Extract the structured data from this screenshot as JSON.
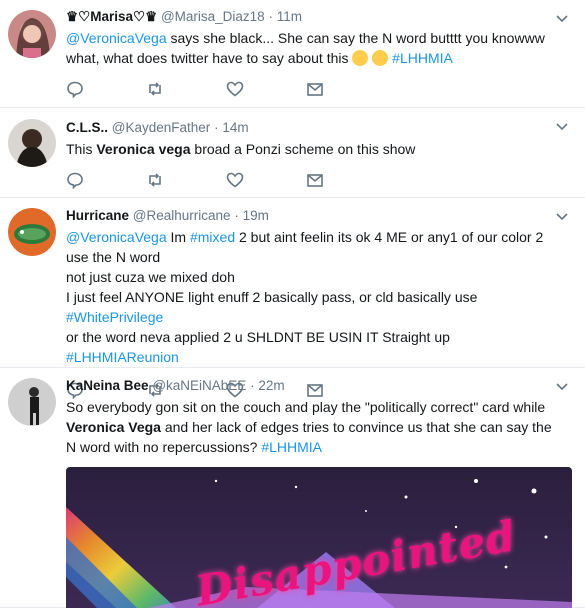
{
  "tweets": [
    {
      "fullname": "♛♡Marisa♡♛",
      "handle": "@Marisa_Diaz18",
      "time": "11m",
      "segments": [
        {
          "type": "mention",
          "text": "@VeronicaVega"
        },
        {
          "type": "text",
          "text": " says she black... She can say the N word butttt you knowww what, what does twitter have to say about this "
        },
        {
          "type": "hashtag",
          "text": "#LHHMIA"
        }
      ],
      "emojis": [
        "face-with-tears-of-joy-emoji",
        "face-without-mouth-emoji"
      ]
    },
    {
      "fullname": "C.L.S..",
      "handle": "@KaydenFather",
      "time": "14m",
      "text_before": "This ",
      "bold": "Veronica vega",
      "text_after": " broad a Ponzi scheme on this show"
    },
    {
      "fullname": "Hurricane",
      "handle": "@Realhurricane",
      "time": "19m",
      "line1_mention": "@VeronicaVega",
      "line1_text_a": " Im ",
      "line1_hashtag": "#mixed",
      "line1_text_b": " 2 but aint feelin its ok 4 ME or any1 of our color 2 use the N word",
      "line2": "not just cuza we mixed doh",
      "line3_text": "I just feel ANYONE light enuff 2 basically pass, or cld basically use ",
      "line3_hashtag": "#WhitePrivilege",
      "line4_text": "or the word neva applied 2 u SHLDNT BE USIN IT Straight up ",
      "line4_hashtag": "#LHHMIAReunion"
    },
    {
      "fullname": "KaNeina Bee",
      "handle": "@kaNEiNAbEE",
      "time": "22m",
      "text_a": "So everybody gon sit on the couch and play the \"politically correct\" card while ",
      "bold": "Veronica Vega",
      "text_b": " and her lack of edges tries to convince us that she can say the N word with no repercussions? ",
      "hashtag": "#LHHMIA",
      "media_text": "Disappointed"
    }
  ],
  "dot": "·",
  "colors": {
    "link": "#1b95e0",
    "muted": "#657786",
    "border": "#e6ecf0"
  }
}
